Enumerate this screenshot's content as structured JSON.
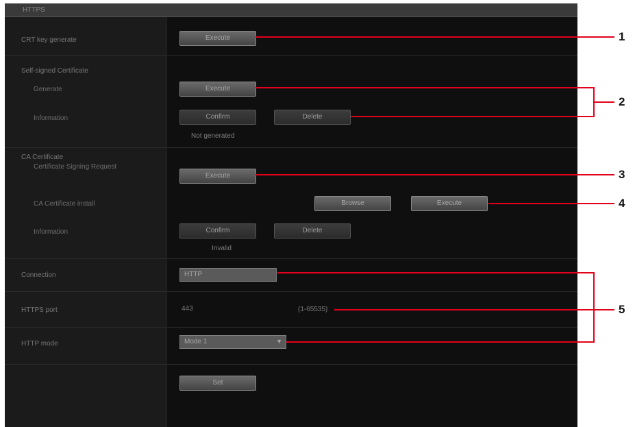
{
  "window": {
    "title": "HTTPS"
  },
  "labels": {
    "crt_key_generate": "CRT key generate",
    "self_signed_certificate": "Self-signed Certificate",
    "generate": "Generate",
    "information": "Information",
    "ca_certificate": "CA Certificate",
    "ca_certificate_request": "Certificate Signing Request",
    "ca_certificate_install": "CA Certificate install",
    "ca_information": "Information",
    "connection": "Connection",
    "https_port": "HTTPS port",
    "http_mode": "HTTP mode"
  },
  "buttons": {
    "crt_execute": "Execute",
    "self_signed_execute": "Execute",
    "self_signed_confirm": "Confirm",
    "self_signed_delete": "Delete",
    "csr_execute": "Execute",
    "ca_browse": "Browse",
    "ca_execute": "Execute",
    "ca_confirm": "Confirm",
    "ca_delete": "Delete",
    "set": "Set"
  },
  "status": {
    "self_signed_status": "Not generated",
    "ca_status": "Invalid"
  },
  "fields": {
    "connection_value": "HTTP",
    "https_port_value": "443",
    "https_port_range": "(1-65535)",
    "http_mode_value": "Mode 1"
  },
  "callouts": [
    "1",
    "2",
    "3",
    "4",
    "5"
  ]
}
